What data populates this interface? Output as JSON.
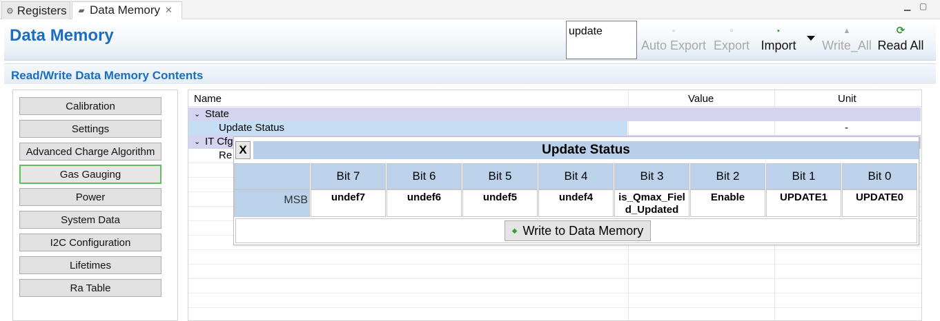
{
  "tabs": [
    {
      "label": "Registers",
      "icon": "gear-icon"
    },
    {
      "label": "Data Memory",
      "icon": "memory-icon"
    }
  ],
  "header": {
    "title": "Data Memory",
    "search_value": "update",
    "toolbar": {
      "auto_export": "Auto Export",
      "export": "Export",
      "import": "Import",
      "write_all": "Write_All",
      "read_all": "Read All"
    }
  },
  "section": {
    "title": "Read/Write Data Memory Contents"
  },
  "categories": [
    "Calibration",
    "Settings",
    "Advanced Charge Algorithm",
    "Gas Gauging",
    "Power",
    "System Data",
    "I2C Configuration",
    "Lifetimes",
    "Ra Table"
  ],
  "selected_category": "Gas Gauging",
  "table": {
    "columns": {
      "name": "Name",
      "value": "Value",
      "unit": "Unit"
    },
    "rows": [
      {
        "name": "State",
        "type": "group",
        "expanded": true
      },
      {
        "name": "Update Status",
        "type": "item",
        "value": "",
        "unit": "-"
      },
      {
        "name": "IT Cfg",
        "type": "group",
        "expanded": true
      },
      {
        "name": "Re",
        "type": "item",
        "value": "",
        "unit": ""
      }
    ]
  },
  "popup": {
    "close_label": "X",
    "title": "Update Status",
    "row_label": "MSB",
    "bits": [
      {
        "label": "Bit 7",
        "value": "undef7"
      },
      {
        "label": "Bit 6",
        "value": "undef6"
      },
      {
        "label": "Bit 5",
        "value": "undef5"
      },
      {
        "label": "Bit 4",
        "value": "undef4"
      },
      {
        "label": "Bit 3",
        "value": "is_Qmax_Fiel\nd_Updated"
      },
      {
        "label": "Bit 2",
        "value": "Enable"
      },
      {
        "label": "Bit 1",
        "value": "UPDATE1"
      },
      {
        "label": "Bit 0",
        "value": "UPDATE0"
      }
    ],
    "write_button": "Write to Data Memory"
  },
  "colors": {
    "title_blue": "#1b6dc2",
    "group_row": "#d4d4f0",
    "selected_row": "#c5def4",
    "bit_header": "#bcd1ea",
    "selected_border": "#5fbf5f"
  }
}
